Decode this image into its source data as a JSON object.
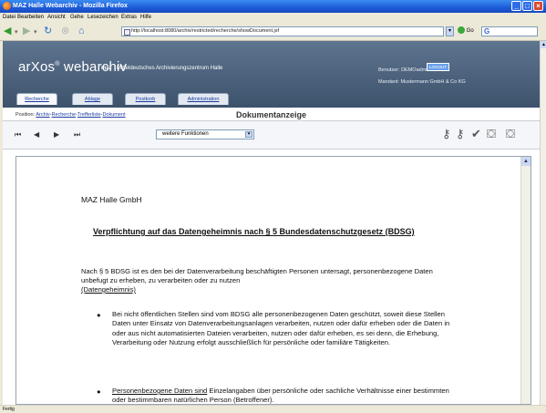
{
  "window": {
    "title": "MAZ Halle Webarchiv - Mozilla Firefox"
  },
  "menu": {
    "items": [
      "Datei",
      "Bearbeiten",
      "Ansicht",
      "Gehe",
      "Lesezeichen",
      "Extras",
      "Hilfe"
    ]
  },
  "browser": {
    "url": "http://localhost:8080/archiv/restricted/recherche/showDocument.jsf",
    "status": "Fertig"
  },
  "header": {
    "brand": "arXos",
    "brand_reg": "®",
    "brand_suffix": " webarchiv",
    "sub_bold": "maz",
    "sub_text": " · Mitteldeutsches Archivierungszentrum Halle",
    "user_label": "Benutzer: DEMOadmin",
    "logout_label": "LOGOUT",
    "mandant_label": "Mandant: Mustermann GmbH & Co KG"
  },
  "tabs": [
    "Recherche",
    "Ablage",
    "Postkorb",
    "Administration"
  ],
  "position": {
    "label": "Position:",
    "crumbs": [
      "Archiv",
      "Recherche",
      "Trefferliste",
      "Dokument"
    ]
  },
  "doc_title": "Dokumentanzeige",
  "controls": {
    "function_select": "weitere Funktionen"
  },
  "document": {
    "company": "MAZ Halle GmbH",
    "heading": "Verpflichtung auf das Datengeheimnis nach § 5 Bundesdatenschutzgesetz (BDSG)",
    "para1": "Nach § 5 BDSG ist es den bei der Datenverarbeitung beschäftigten Personen untersagt, personenbezogene Daten unbefugt zu erheben, zu verarbeiten oder zu nutzen",
    "para1_u": "(Datengeheimnis)",
    "bullet1": "Bei nicht öffentlichen Stellen sind vom BDSG alle personenbezogenen Daten geschützt, soweit diese Stellen Daten unter Einsatz von Datenverarbeitungsanlagen verarbeiten, nutzen oder dafür erheben oder die Daten in oder aus nicht automatisierten Dateien verarbeiten, nutzen oder dafür erheben, es sei denn, die Erhebung, Verarbeitung oder Nutzung erfolgt ausschließlich für persönliche oder familiäre Tätigkeiten.",
    "bullet2_u": "Personenbezogene Daten sind",
    "bullet2": " Einzelangaben über persönliche oder sachliche Verhältnisse einer bestimmten oder bestimmbaren natürlichen Person (Betroffener)."
  }
}
